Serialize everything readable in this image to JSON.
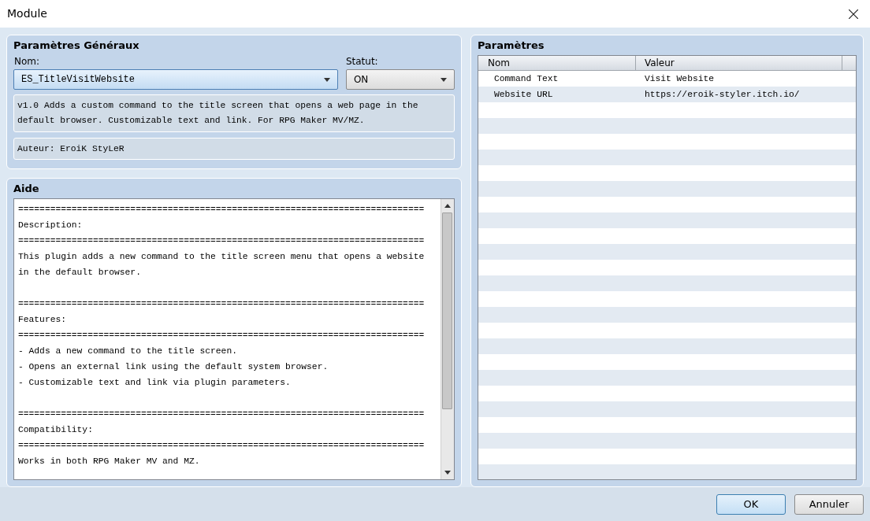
{
  "window": {
    "title": "Module"
  },
  "general": {
    "title": "Paramètres Généraux",
    "name_label": "Nom:",
    "name_value": "ES_TitleVisitWebsite",
    "status_label": "Statut:",
    "status_value": "ON",
    "description": "v1.0 Adds a custom command to the title screen that opens a web page in the default browser. Customizable text and link. For RPG Maker MV/MZ.",
    "author": "Auteur: EroiK StyLeR"
  },
  "help": {
    "title": "Aide",
    "blocks": [
      {
        "lines": [
          "============================================================================",
          "Description:",
          "============================================================================",
          "This plugin adds a new command to the title screen menu that opens a website",
          "in the default browser."
        ]
      },
      {
        "lines": [
          "============================================================================",
          "Features:",
          "============================================================================",
          "- Adds a new command to the title screen.",
          "- Opens an external link using the default system browser.",
          "- Customizable text and link via plugin parameters."
        ]
      },
      {
        "lines": [
          "============================================================================",
          "Compatibility:",
          "============================================================================",
          "Works in both RPG Maker MV and MZ."
        ]
      }
    ]
  },
  "parameters": {
    "title": "Paramètres",
    "columns": [
      "Nom",
      "Valeur"
    ],
    "rows": [
      {
        "name": "Command Text",
        "value": "Visit Website"
      },
      {
        "name": "Website URL",
        "value": "https://eroik-styler.itch.io/"
      }
    ]
  },
  "buttons": [
    {
      "label": "OK",
      "kind": "primary"
    },
    {
      "label": "Annuler",
      "kind": "normal"
    }
  ]
}
